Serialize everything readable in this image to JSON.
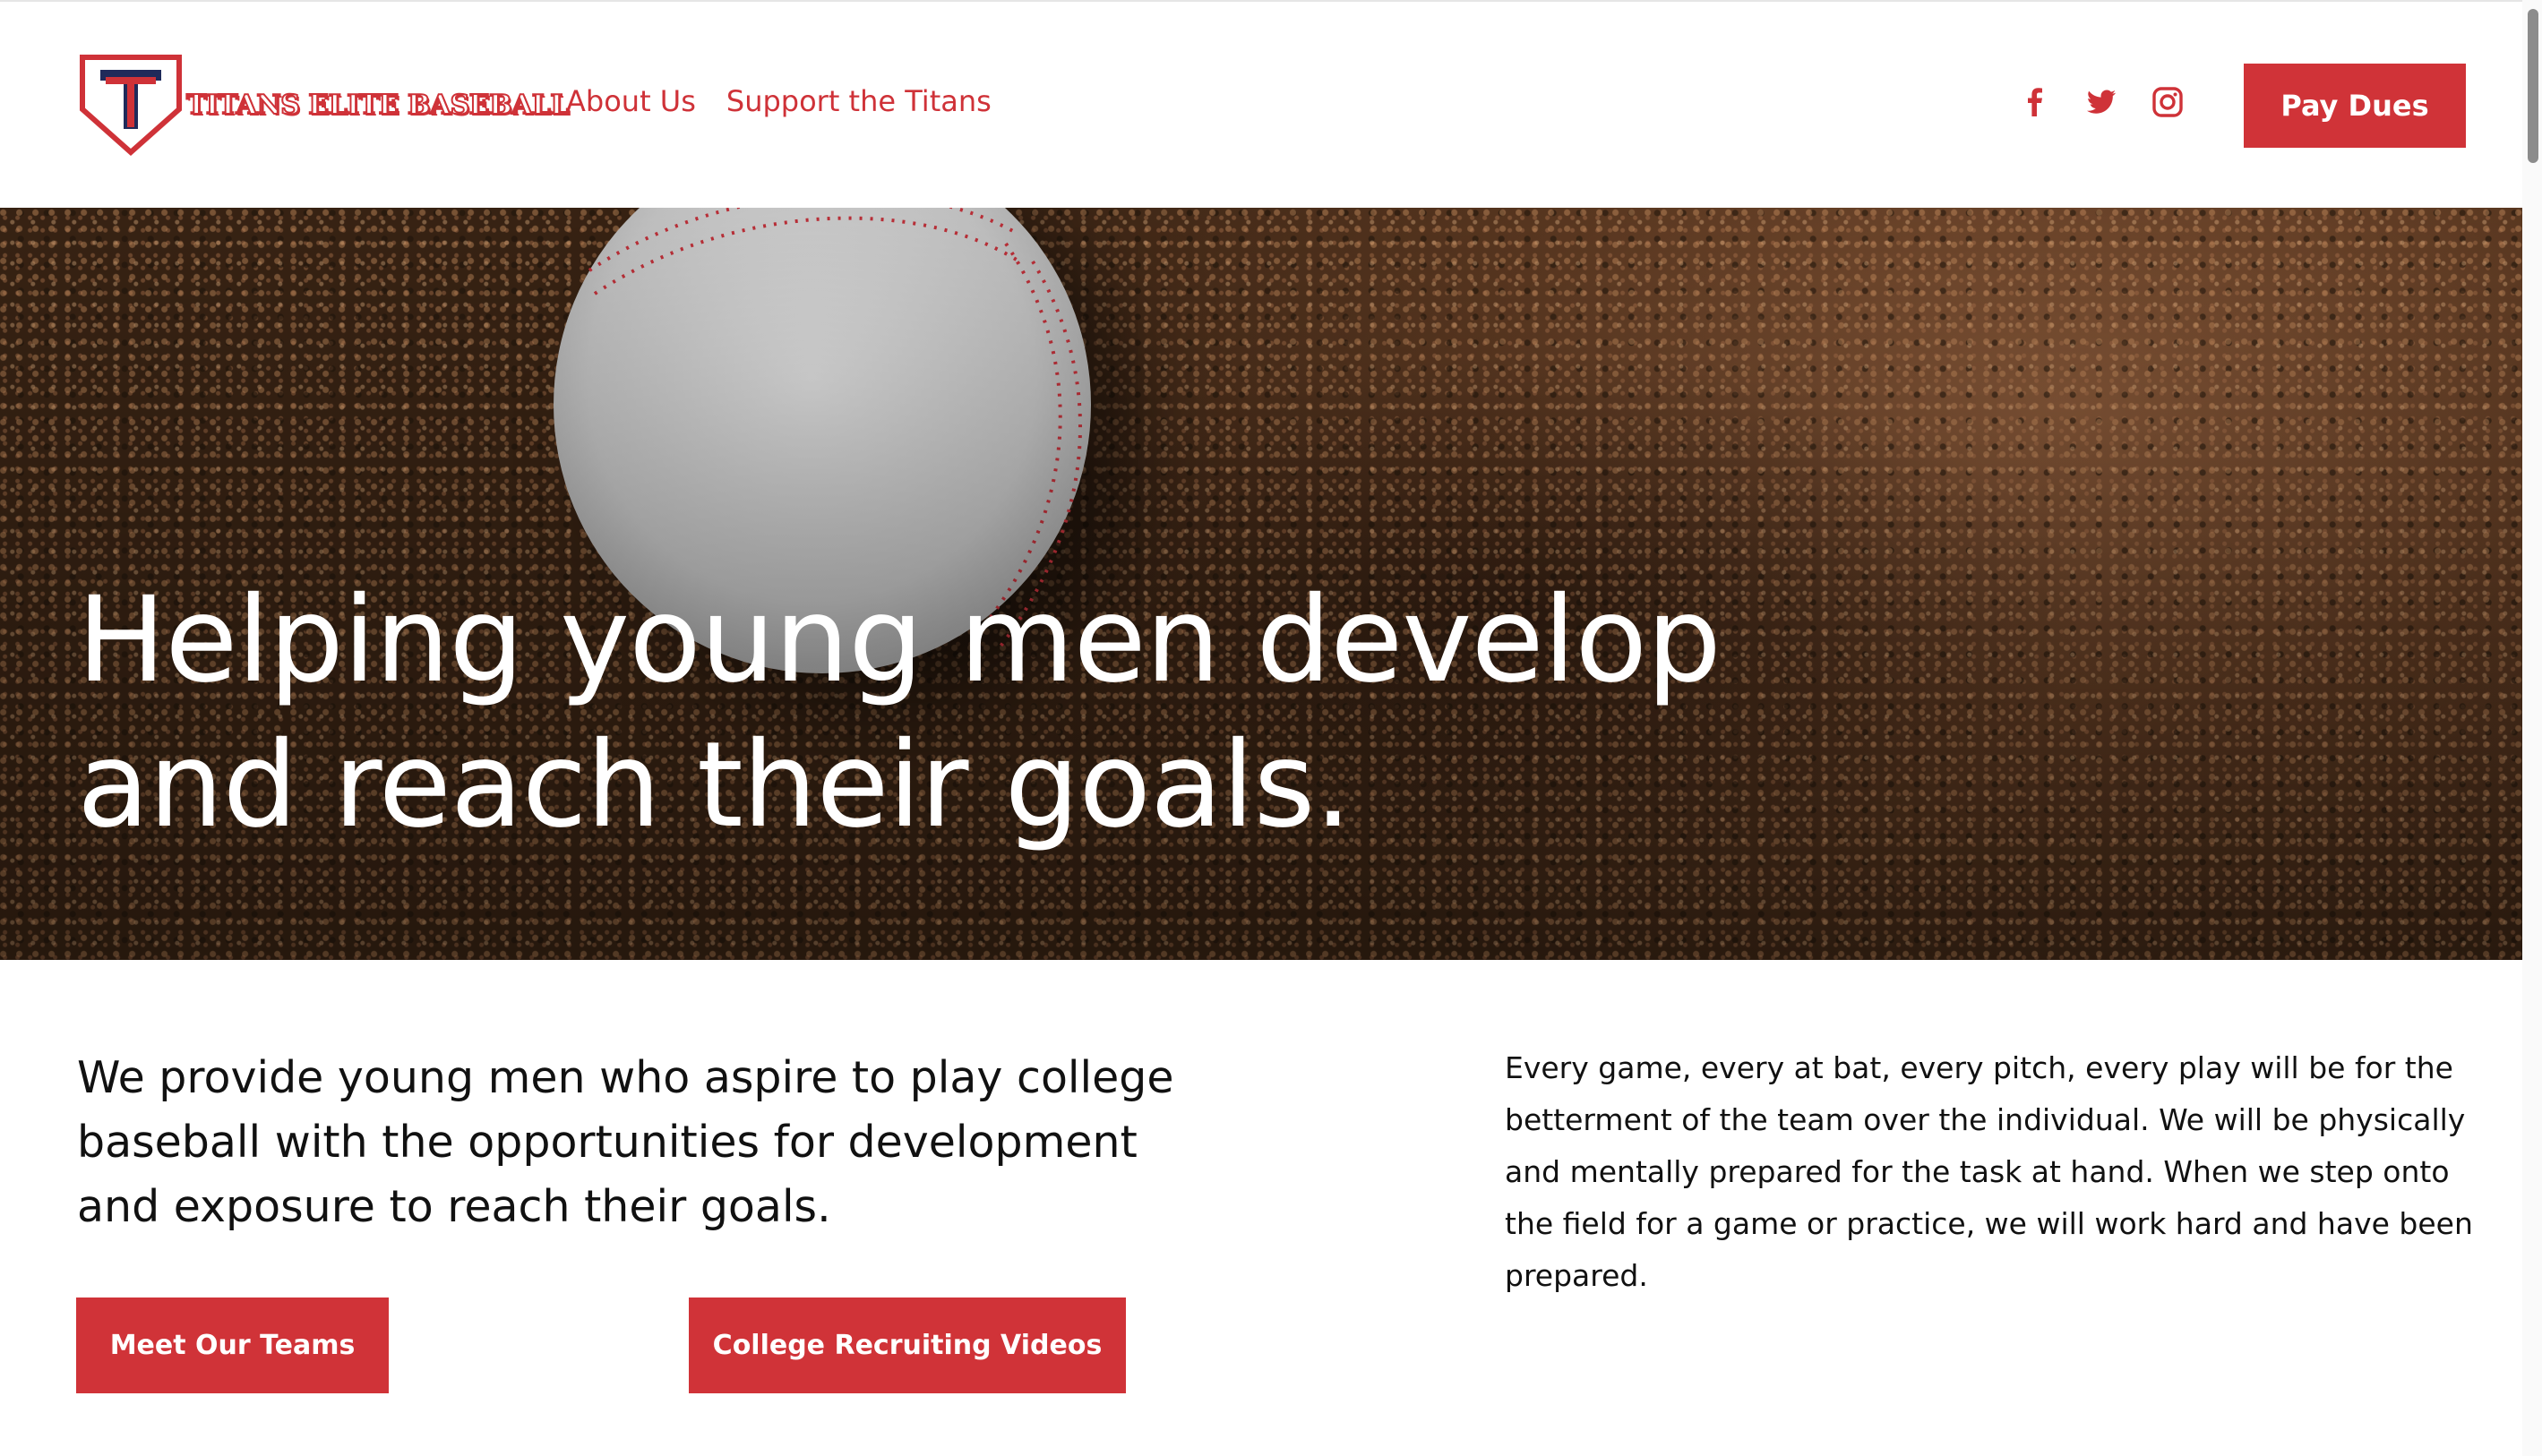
{
  "brand": {
    "name": "TITANS ELITE BASEBALL",
    "logo_letter": "T",
    "accent_color": "#d03338",
    "navy_color": "#1f2a5a"
  },
  "nav": {
    "items": [
      {
        "label": "About Us"
      },
      {
        "label": "Support the Titans"
      }
    ]
  },
  "social": [
    {
      "icon": "facebook-icon"
    },
    {
      "icon": "twitter-icon"
    },
    {
      "icon": "instagram-icon"
    }
  ],
  "header": {
    "cta_label": "Pay Dues"
  },
  "hero": {
    "title": "Helping young men develop and reach their goals."
  },
  "intro": {
    "mission": "We provide young men who aspire to play college baseball with the opportunities for development and exposure to reach their goals.",
    "creed": "Every game, every at bat, every pitch, every play will be for the betterment of the team over the individual. We will be physically and mentally prepared for the task at hand. When we step onto the field for a game or practice, we will work hard and have been prepared."
  },
  "buttons": {
    "teams_label": "Meet Our Teams",
    "videos_label": "College Recruiting Videos"
  }
}
